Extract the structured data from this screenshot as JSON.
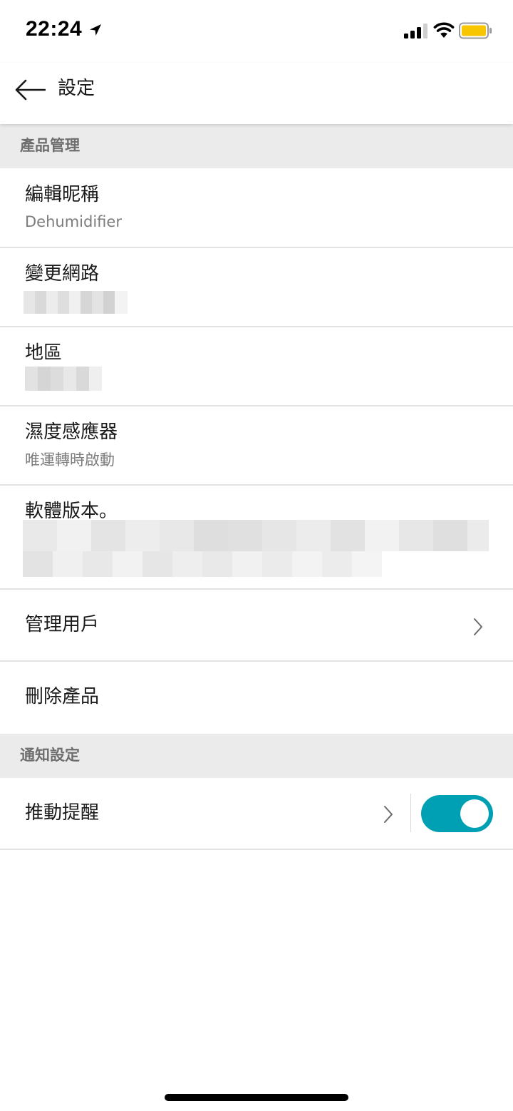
{
  "status_bar": {
    "time": "22:24",
    "battery_color": "#f7c600"
  },
  "header": {
    "title": "設定"
  },
  "sections": {
    "product": {
      "label": "產品管理",
      "rows": {
        "nickname": {
          "title": "編輯昵稱",
          "value": "Dehumidifier"
        },
        "network": {
          "title": "變更網路",
          "value_redacted": true
        },
        "region": {
          "title": "地區",
          "value_redacted": true
        },
        "humidity_sensor": {
          "title": "濕度感應器",
          "value": "唯運轉時啟動"
        },
        "firmware": {
          "title": "軟體版本。",
          "value_redacted": true
        },
        "manage_users": {
          "title": "管理用戶"
        },
        "delete_product": {
          "title": "刪除產品"
        }
      }
    },
    "notifications": {
      "label": "通知設定",
      "rows": {
        "push": {
          "title": "推動提醒",
          "enabled": true
        }
      }
    }
  },
  "colors": {
    "accent": "#00a0b4",
    "section_bg": "#ebebeb",
    "divider": "#e3e3e3"
  }
}
